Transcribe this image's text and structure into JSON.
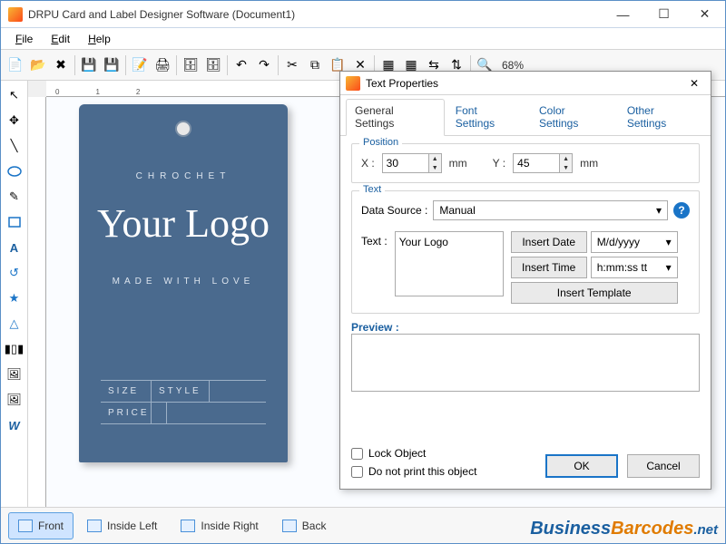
{
  "window": {
    "title": "DRPU Card and Label Designer Software (Document1)"
  },
  "menubar": [
    "File",
    "Edit",
    "Help"
  ],
  "toolbar": {
    "zoom": "68%"
  },
  "page_tabs": [
    {
      "label": "Front",
      "active": true
    },
    {
      "label": "Inside Left",
      "active": false
    },
    {
      "label": "Inside Right",
      "active": false
    },
    {
      "label": "Back",
      "active": false
    }
  ],
  "label_design": {
    "arc_top": "CHROCHET",
    "script": "Your Logo",
    "arc_bottom": "MADE WITH LOVE",
    "fields": {
      "size": "SIZE",
      "style": "STYLE",
      "price": "PRICE"
    }
  },
  "dialog": {
    "title": "Text Properties",
    "tabs": [
      "General Settings",
      "Font Settings",
      "Color Settings",
      "Other Settings"
    ],
    "position": {
      "section_label": "Position",
      "x_label": "X :",
      "x_value": "30",
      "x_unit": "mm",
      "y_label": "Y :",
      "y_value": "45",
      "y_unit": "mm"
    },
    "text_section": {
      "section_label": "Text",
      "data_source_label": "Data Source :",
      "data_source_value": "Manual",
      "text_label": "Text :",
      "text_value": "Your Logo",
      "insert_date_label": "Insert Date",
      "date_format": "M/d/yyyy",
      "insert_time_label": "Insert Time",
      "time_format": "h:mm:ss tt",
      "insert_template_label": "Insert Template"
    },
    "preview_label": "Preview :",
    "lock_object_label": "Lock Object",
    "do_not_print_label": "Do not print this object",
    "ok_label": "OK",
    "cancel_label": "Cancel"
  },
  "brand": {
    "p1": "Business",
    "p2": "Barcodes",
    "p3": ".net"
  }
}
